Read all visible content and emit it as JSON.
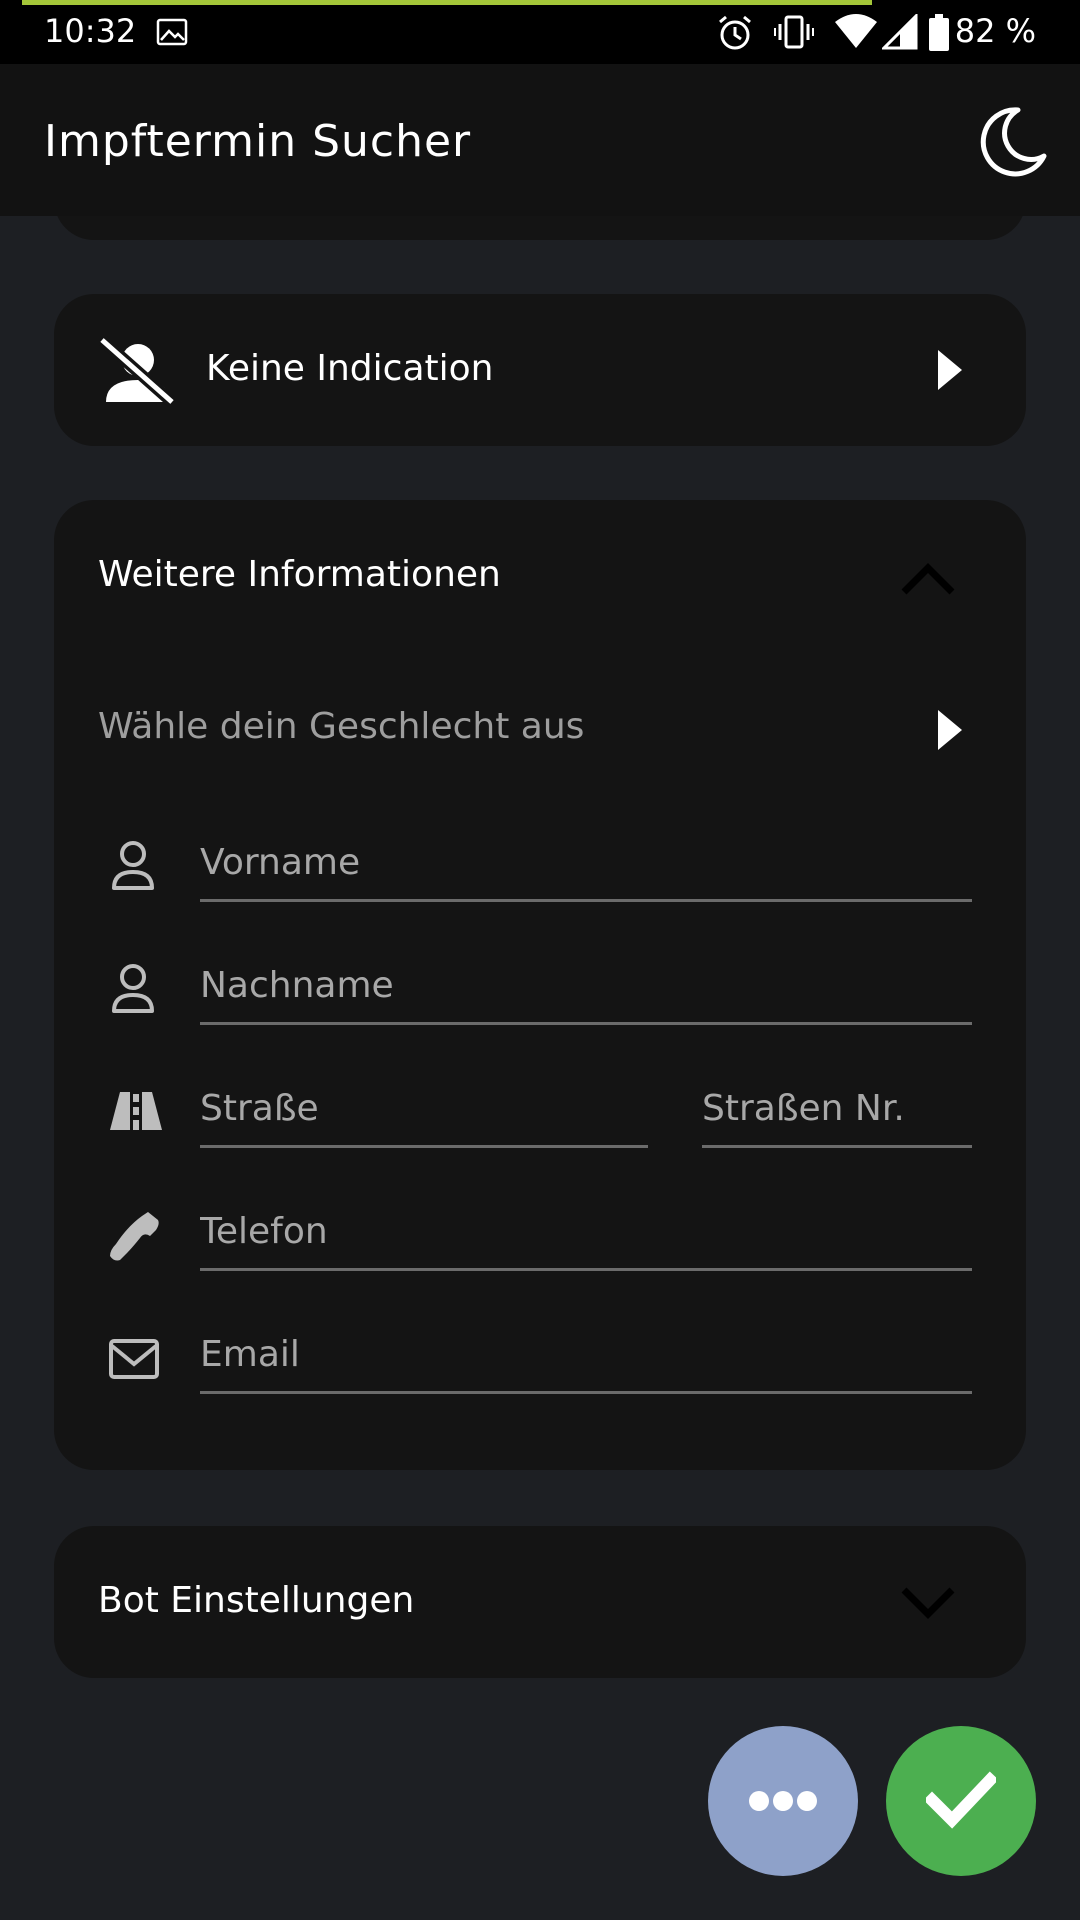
{
  "status_bar": {
    "time": "10:32",
    "battery_text": "82 %",
    "icons": [
      "image-icon",
      "alarm-icon",
      "vibrate-icon",
      "wifi-icon",
      "signal-icon",
      "battery-icon"
    ]
  },
  "app_bar": {
    "title": "Impftermin Sucher",
    "theme_icon": "moon-icon"
  },
  "indication": {
    "label": "Keine Indication",
    "icon": "person-off-icon"
  },
  "info_section": {
    "title": "Weitere Informationen",
    "gender_label": "Wähle dein Geschlecht aus",
    "fields": {
      "first_name": {
        "placeholder": "Vorname",
        "value": ""
      },
      "last_name": {
        "placeholder": "Nachname",
        "value": ""
      },
      "street": {
        "placeholder": "Straße",
        "value": ""
      },
      "street_nr": {
        "placeholder": "Straßen Nr.",
        "value": ""
      },
      "phone": {
        "placeholder": "Telefon",
        "value": ""
      },
      "email": {
        "placeholder": "Email",
        "value": ""
      }
    }
  },
  "bot_section": {
    "title": "Bot Einstellungen"
  },
  "fabs": {
    "more_icon": "more-horiz-icon",
    "confirm_icon": "check-icon"
  },
  "colors": {
    "background": "#1d1f23",
    "card": "#141414",
    "app_bar": "#121212",
    "fab_more": "#8ea1c9",
    "fab_confirm": "#4caf50",
    "status_progress": "#a4c639"
  }
}
